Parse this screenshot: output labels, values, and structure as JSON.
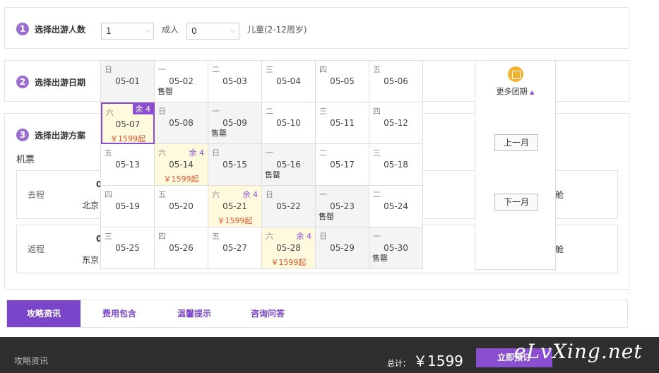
{
  "steps": {
    "s1": {
      "num": "1",
      "title": "选择出游人数"
    },
    "s2": {
      "num": "2",
      "title": "选择出游日期"
    },
    "s3": {
      "num": "3",
      "title": "选择出游方案"
    }
  },
  "people": {
    "adults_value": "1",
    "adults_label": "成人",
    "children_value": "0",
    "children_label": "儿童(2-12周岁)"
  },
  "section_flights": "机票",
  "flights": [
    {
      "label": "去程",
      "a": "0",
      "c": "北京",
      "cabin": "舱"
    },
    {
      "label": "返程",
      "a": "0",
      "c": "东京",
      "cabin": "舱"
    }
  ],
  "calendar": {
    "cells": [
      {
        "wd": "日",
        "date": "05-01",
        "style": "gray"
      },
      {
        "wd": "一",
        "date": "05-02",
        "sold": "售罄",
        "style": "plain"
      },
      {
        "wd": "二",
        "date": "05-03",
        "style": "plain"
      },
      {
        "wd": "三",
        "date": "05-04",
        "style": "plain"
      },
      {
        "wd": "四",
        "date": "05-05",
        "style": "plain"
      },
      {
        "wd": "五",
        "date": "05-06",
        "style": "plain"
      },
      {
        "wd": "六",
        "date": "05-07",
        "remain": "余 4",
        "price": "￥1599起",
        "style": "sel"
      },
      {
        "wd": "日",
        "date": "05-08",
        "style": "gray"
      },
      {
        "wd": "一",
        "date": "05-09",
        "sold": "售罄",
        "style": "gray"
      },
      {
        "wd": "二",
        "date": "05-10",
        "style": "plain"
      },
      {
        "wd": "三",
        "date": "05-11",
        "style": "plain"
      },
      {
        "wd": "四",
        "date": "05-12",
        "style": "plain"
      },
      {
        "wd": "五",
        "date": "05-13",
        "style": "plain"
      },
      {
        "wd": "六",
        "date": "05-14",
        "remain": "余 4",
        "price": "￥1599起",
        "style": "avail"
      },
      {
        "wd": "日",
        "date": "05-15",
        "style": "gray"
      },
      {
        "wd": "一",
        "date": "05-16",
        "sold": "售罄",
        "style": "gray"
      },
      {
        "wd": "二",
        "date": "05-17",
        "style": "plain"
      },
      {
        "wd": "三",
        "date": "05-18",
        "style": "plain"
      },
      {
        "wd": "四",
        "date": "05-19",
        "style": "plain"
      },
      {
        "wd": "五",
        "date": "05-20",
        "style": "plain"
      },
      {
        "wd": "六",
        "date": "05-21",
        "remain": "余 4",
        "price": "￥1599起",
        "style": "avail"
      },
      {
        "wd": "日",
        "date": "05-22",
        "style": "gray"
      },
      {
        "wd": "一",
        "date": "05-23",
        "sold": "售罄",
        "style": "gray"
      },
      {
        "wd": "二",
        "date": "05-24",
        "style": "plain"
      },
      {
        "wd": "三",
        "date": "05-25",
        "style": "plain"
      },
      {
        "wd": "四",
        "date": "05-26",
        "style": "plain"
      },
      {
        "wd": "五",
        "date": "05-27",
        "style": "plain"
      },
      {
        "wd": "六",
        "date": "05-28",
        "remain": "余 4",
        "price": "￥1599起",
        "style": "avail"
      },
      {
        "wd": "日",
        "date": "05-29",
        "style": "gray"
      },
      {
        "wd": "一",
        "date": "05-30",
        "sold": "售罄",
        "style": "gray"
      }
    ],
    "more": "更多团期",
    "prev": "上一月",
    "next": "下一月"
  },
  "tabs": [
    {
      "label": "攻略资讯",
      "active": true
    },
    {
      "label": "费用包含",
      "active": false
    },
    {
      "label": "温馨提示",
      "active": false
    },
    {
      "label": "咨询问答",
      "active": false
    }
  ],
  "bottom": {
    "left": "攻略资讯",
    "total_label": "总计：",
    "total_value": "￥1599",
    "buy": "立即预订",
    "watermark": "eLvXing.net"
  },
  "colors": {
    "accent": "#8a4fd0",
    "price": "#e0552b",
    "icon": "#f2b234"
  }
}
